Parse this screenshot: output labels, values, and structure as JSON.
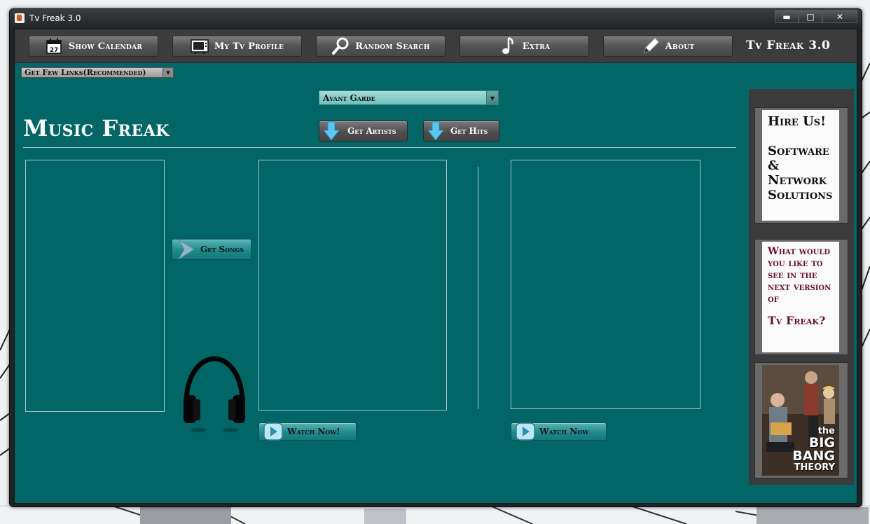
{
  "window": {
    "title": "Tv Freak 3.0",
    "controls": {
      "minimize": "▬",
      "maximize": "□",
      "close": "✕"
    }
  },
  "toolbar": {
    "buttons": [
      {
        "label": "Show Calendar",
        "icon": "calendar-icon",
        "icon_text": "27"
      },
      {
        "label": "My Tv Profile",
        "icon": "tv-icon"
      },
      {
        "label": "Random Search",
        "icon": "magnifier-icon"
      },
      {
        "label": "Extra",
        "icon": "music-note-icon"
      },
      {
        "label": "About",
        "icon": "pencil-icon"
      }
    ],
    "brand": "Tv Freak 3.0"
  },
  "links_select": {
    "value": "Get Few Links(Recommended)"
  },
  "genre_select": {
    "value": "Avant Garde"
  },
  "section": {
    "title": "Music Freak"
  },
  "actions": {
    "get_artists": "Get Artists",
    "get_hits": "Get Hits",
    "get_songs": "Get Songs",
    "watch_now_left": "Watch Now!",
    "watch_now_right": "Watch Now"
  },
  "sidebar": {
    "ad1": {
      "text": "Hire Us!\n\nSoftware\n&\nNetwork\nSolutions"
    },
    "ad2": {
      "text": "What would you like to see in the next version of",
      "text2": "Tv Freak?"
    },
    "ad3": {
      "title_small_1": "the",
      "title_big_1": "BIG",
      "title_big_2": "BANG",
      "title_small_2": "THEORY"
    }
  },
  "colors": {
    "accent_teal": "#026566",
    "toolbar": "#3c3c3c",
    "ad_text_red": "#6a0f2a"
  }
}
